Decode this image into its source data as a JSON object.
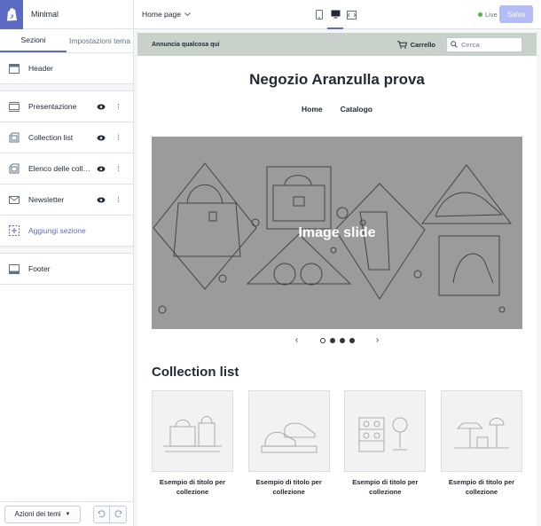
{
  "app": {
    "theme_name": "Minimal"
  },
  "sidebar": {
    "tabs": [
      {
        "label": "Sezioni",
        "active": true
      },
      {
        "label": "Impostazioni tema",
        "active": false
      }
    ],
    "header_label": "Header",
    "sections": [
      {
        "label": "Presentazione",
        "icon": "slideshow-icon"
      },
      {
        "label": "Collection list",
        "icon": "collection-icon"
      },
      {
        "label": "Elenco delle collezioni",
        "icon": "collection-icon"
      },
      {
        "label": "Newsletter",
        "icon": "mail-icon"
      }
    ],
    "add_section_label": "Aggiungi sezione",
    "footer_label": "Footer",
    "actions_label": "Azioni dei temi"
  },
  "topbar": {
    "page_label": "Home page",
    "live_label": "Live",
    "save_label": "Salva"
  },
  "preview": {
    "announcement": "Annuncia qualcosa qui",
    "cart_label": "Carrello",
    "search_placeholder": "Cerca",
    "store_title": "Negozio Aranzulla prova",
    "nav": [
      "Home",
      "Catalogo"
    ],
    "slide_text": "Image slide",
    "slide_count": 4,
    "active_slide": 0,
    "collection_title": "Collection list",
    "collections": [
      "Esempio di titolo per collezione",
      "Esempio di titolo per collezione",
      "Esempio di titolo per collezione",
      "Esempio di titolo per collezione"
    ]
  },
  "colors": {
    "accent": "#5c6ac4",
    "announcement_bg": "#c9d1cb",
    "slide_bg": "#9b9b9b",
    "save_bg": "#b3bcf5",
    "live_dot": "#50b83c"
  }
}
